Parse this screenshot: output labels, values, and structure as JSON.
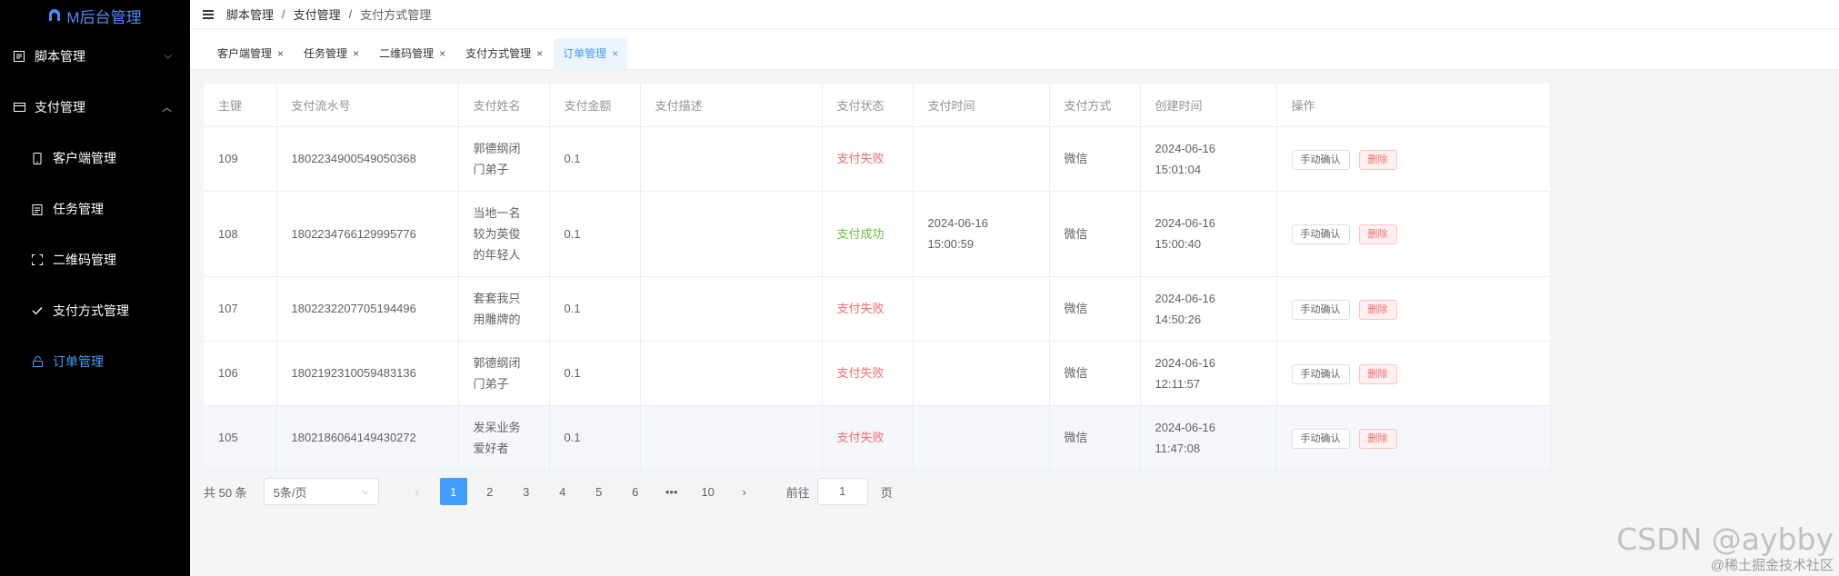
{
  "sidebar": {
    "logo_text": "M后台管理",
    "menu": [
      {
        "label": "脚本管理",
        "icon": "script-icon",
        "expanded": false
      },
      {
        "label": "支付管理",
        "icon": "payment-icon",
        "expanded": true
      }
    ],
    "sub_items": [
      {
        "label": "客户端管理",
        "icon": "phone-icon"
      },
      {
        "label": "任务管理",
        "icon": "task-icon"
      },
      {
        "label": "二维码管理",
        "icon": "qrcode-icon"
      },
      {
        "label": "支付方式管理",
        "icon": "check-icon"
      },
      {
        "label": "订单管理",
        "icon": "lock-icon",
        "active": true
      }
    ]
  },
  "header": {
    "breadcrumb": [
      "脚本管理",
      "支付管理",
      "支付方式管理"
    ],
    "separator": "/"
  },
  "tabs": [
    {
      "label": "客户端管理",
      "close": "×"
    },
    {
      "label": "任务管理",
      "close": "×"
    },
    {
      "label": "二维码管理",
      "close": "×"
    },
    {
      "label": "支付方式管理",
      "close": "×"
    },
    {
      "label": "订单管理",
      "close": "×",
      "active": true
    }
  ],
  "table": {
    "columns": [
      "主键",
      "支付流水号",
      "支付姓名",
      "支付金额",
      "支付描述",
      "支付状态",
      "支付时间",
      "支付方式",
      "创建时间",
      "操作"
    ],
    "rows": [
      {
        "id": "109",
        "serial": "1802234900549050368",
        "name_l1": "郭德纲闭",
        "name_l2": "门弟子",
        "name_l3": "",
        "amount": "0.1",
        "desc": "",
        "status": "支付失败",
        "status_type": "fail",
        "pay_date": "",
        "pay_time": "",
        "method": "微信",
        "c_date": "2024-06-16",
        "c_time": "15:01:04"
      },
      {
        "id": "108",
        "serial": "1802234766129995776",
        "name_l1": "当地一名",
        "name_l2": "较为英俊",
        "name_l3": "的年轻人",
        "amount": "0.1",
        "desc": "",
        "status": "支付成功",
        "status_type": "ok",
        "pay_date": "2024-06-16",
        "pay_time": "15:00:59",
        "method": "微信",
        "c_date": "2024-06-16",
        "c_time": "15:00:40"
      },
      {
        "id": "107",
        "serial": "1802232207705194496",
        "name_l1": "套套我只",
        "name_l2": "用雕牌的",
        "name_l3": "",
        "amount": "0.1",
        "desc": "",
        "status": "支付失败",
        "status_type": "fail",
        "pay_date": "",
        "pay_time": "",
        "method": "微信",
        "c_date": "2024-06-16",
        "c_time": "14:50:26"
      },
      {
        "id": "106",
        "serial": "1802192310059483136",
        "name_l1": "郭德纲闭",
        "name_l2": "门弟子",
        "name_l3": "",
        "amount": "0.1",
        "desc": "",
        "status": "支付失败",
        "status_type": "fail",
        "pay_date": "",
        "pay_time": "",
        "method": "微信",
        "c_date": "2024-06-16",
        "c_time": "12:11:57"
      },
      {
        "id": "105",
        "serial": "1802186064149430272",
        "name_l1": "发呆业务",
        "name_l2": "爱好者",
        "name_l3": "",
        "amount": "0.1",
        "desc": "",
        "status": "支付失败",
        "status_type": "fail",
        "pay_date": "",
        "pay_time": "",
        "method": "微信",
        "c_date": "2024-06-16",
        "c_time": "11:47:08"
      }
    ],
    "actions": {
      "confirm": "手动确认",
      "delete": "删除"
    }
  },
  "pagination": {
    "total_label": "共 50 条",
    "page_size": "5条/页",
    "prev": "‹",
    "next": "›",
    "pages": [
      "1",
      "2",
      "3",
      "4",
      "5",
      "6",
      "•••",
      "10"
    ],
    "current": "1",
    "goto_label": "前往",
    "goto_value": "1",
    "goto_unit": "页"
  },
  "watermark": {
    "line1": "CSDN @aybby",
    "line2": "@稀土掘金技术社区"
  },
  "colors": {
    "accent": "#409eff",
    "fail": "#f56c6c",
    "success": "#67c23a",
    "sidebar_bg": "#000000"
  }
}
